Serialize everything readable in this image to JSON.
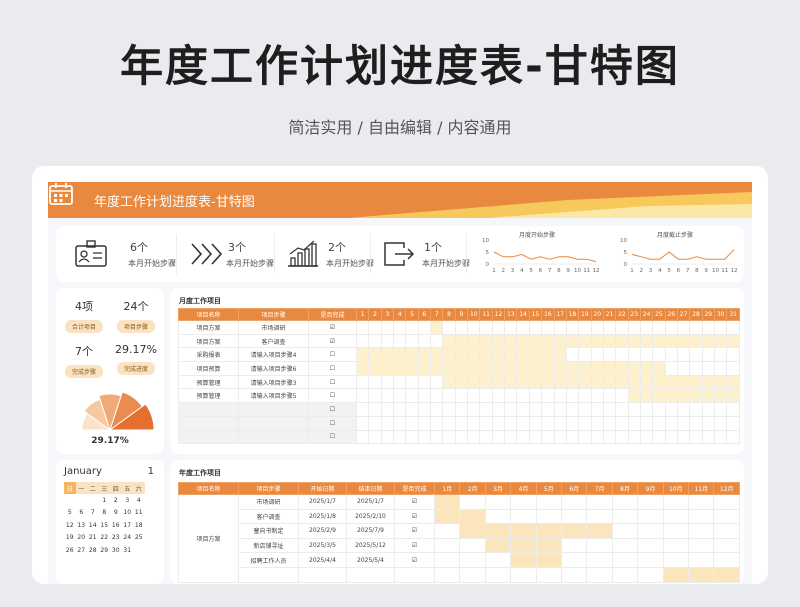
{
  "page": {
    "title": "年度工作计划进度表-甘特图",
    "subtitle": "简洁实用 / 自由编辑 / 内容通用"
  },
  "banner": {
    "title": "年度工作计划进度表-甘特图"
  },
  "colors": {
    "accent": "#e9883f",
    "bar": "#fdf0cc",
    "header": "#e9883f",
    "gold": "#f7c95c"
  },
  "kpis": [
    {
      "value": "6个",
      "label": "本月开始步骤",
      "icon": "id-card-icon"
    },
    {
      "value": "3个",
      "label": "本月开始步骤",
      "icon": "chevrons-right-icon"
    },
    {
      "value": "2个",
      "label": "本月开始步骤",
      "icon": "bar-chart-icon"
    },
    {
      "value": "1个",
      "label": "本月开始步骤",
      "icon": "exit-icon"
    }
  ],
  "chart_data": [
    {
      "type": "line",
      "title": "月度开始步骤",
      "x": [
        1,
        2,
        3,
        4,
        5,
        6,
        7,
        8,
        9,
        10,
        11,
        12
      ],
      "values": [
        5,
        3,
        3,
        4,
        2,
        3,
        2,
        3,
        3,
        2,
        2,
        1
      ],
      "ylim": [
        0,
        10
      ],
      "yticks": [
        0,
        5,
        10
      ]
    },
    {
      "type": "line",
      "title": "月度截止步骤",
      "x": [
        1,
        2,
        3,
        4,
        5,
        6,
        7,
        8,
        9,
        10,
        11,
        12
      ],
      "values": [
        4,
        3,
        2,
        2,
        5,
        2,
        2,
        3,
        2,
        2,
        2,
        6
      ],
      "ylim": [
        0,
        10
      ],
      "yticks": [
        0,
        5,
        10
      ]
    }
  ],
  "stats": [
    {
      "value": "4项",
      "label": "合计项目"
    },
    {
      "value": "24个",
      "label": "项目步骤"
    },
    {
      "value": "7个",
      "label": "完成步骤"
    },
    {
      "value": "29.17%",
      "label": "完成进度"
    }
  ],
  "fan": {
    "percent": "29.17%",
    "progress": 0.2917
  },
  "calendar": {
    "month": "January",
    "day": "1",
    "weekdays": [
      "日",
      "一",
      "二",
      "三",
      "四",
      "五",
      "六"
    ],
    "weeks": [
      [
        "",
        "",
        "",
        "1",
        "2",
        "3",
        "4"
      ],
      [
        "5",
        "6",
        "7",
        "8",
        "9",
        "10",
        "11"
      ],
      [
        "12",
        "13",
        "14",
        "15",
        "16",
        "17",
        "18"
      ],
      [
        "19",
        "20",
        "21",
        "22",
        "23",
        "24",
        "25"
      ],
      [
        "26",
        "27",
        "28",
        "29",
        "30",
        "31",
        ""
      ]
    ]
  },
  "monthly": {
    "title": "月度工作项目",
    "columns": [
      "项目名称",
      "项目步骤",
      "是否完成"
    ],
    "days": [
      "1",
      "2",
      "3",
      "4",
      "5",
      "6",
      "7",
      "8",
      "9",
      "10",
      "11",
      "12",
      "13",
      "14",
      "15",
      "16",
      "17",
      "18",
      "19",
      "20",
      "21",
      "22",
      "23",
      "24",
      "25",
      "26",
      "27",
      "28",
      "29",
      "30",
      "31"
    ],
    "rows": [
      {
        "name": "项目方案",
        "step": "市场调研",
        "done": "☑",
        "start": 7,
        "end": 7
      },
      {
        "name": "项目方案",
        "step": "客户调查",
        "done": "☑",
        "start": 8,
        "end": 31
      },
      {
        "name": "采购报表",
        "step": "请输入项目步骤4",
        "done": "☐",
        "start": 1,
        "end": 17
      },
      {
        "name": "项目预算",
        "step": "请输入项目步骤6",
        "done": "☐",
        "start": 1,
        "end": 25
      },
      {
        "name": "预算管理",
        "step": "请输入项目步骤3",
        "done": "☐",
        "start": 8,
        "end": 31
      },
      {
        "name": "预算管理",
        "step": "请输入项目步骤5",
        "done": "☐",
        "start": 23,
        "end": 31
      },
      {
        "name": "",
        "step": "",
        "done": "☐",
        "start": 0,
        "end": 0
      },
      {
        "name": "",
        "step": "",
        "done": "☐",
        "start": 0,
        "end": 0
      },
      {
        "name": "",
        "step": "",
        "done": "☐",
        "start": 0,
        "end": 0
      }
    ]
  },
  "annual": {
    "title": "年度工作项目",
    "columns": [
      "项目名称",
      "项目步骤",
      "开始日期",
      "结束日期",
      "是否完成"
    ],
    "months": [
      "1月",
      "2月",
      "3月",
      "4月",
      "5月",
      "6月",
      "7月",
      "8月",
      "9月",
      "10月",
      "11月",
      "12月"
    ],
    "group": "项目方案",
    "rows": [
      {
        "step": "市场调研",
        "start": "2025/1/7",
        "end": "2025/1/7",
        "done": "☑",
        "m0": 1,
        "m1": 1
      },
      {
        "step": "客户调查",
        "start": "2025/1/8",
        "end": "2025/2/10",
        "done": "☑",
        "m0": 1,
        "m1": 2
      },
      {
        "step": "塞向书制定",
        "start": "2025/2/9",
        "end": "2025/7/9",
        "done": "☑",
        "m0": 2,
        "m1": 7
      },
      {
        "step": "新店铺寻址",
        "start": "2025/3/5",
        "end": "2025/5/12",
        "done": "☑",
        "m0": 3,
        "m1": 5
      },
      {
        "step": "招聘工作人员",
        "start": "2025/4/4",
        "end": "2025/5/4",
        "done": "☑",
        "m0": 4,
        "m1": 5
      },
      {
        "step": "",
        "start": "",
        "end": "",
        "done": "",
        "m0": 10,
        "m1": 12
      }
    ]
  }
}
